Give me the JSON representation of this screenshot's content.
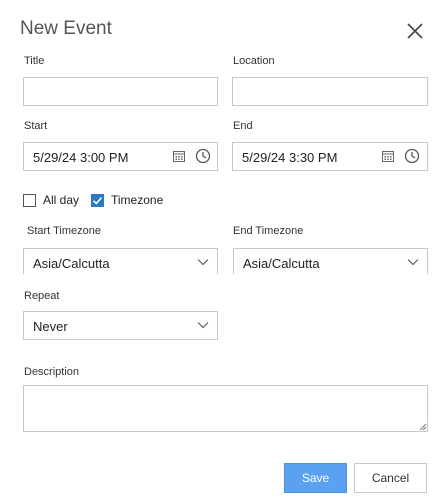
{
  "dialog": {
    "title": "New Event"
  },
  "fields": {
    "title_label": "Title",
    "title_value": "",
    "location_label": "Location",
    "location_value": "",
    "start_label": "Start",
    "start_value": "5/29/24 3:00 PM",
    "end_label": "End",
    "end_value": "5/29/24 3:30 PM"
  },
  "options": {
    "allday_label": "All day",
    "allday_checked": false,
    "timezone_label": "Timezone",
    "timezone_checked": true
  },
  "timezones": {
    "start_label": "Start Timezone",
    "start_value": "Asia/Calcutta",
    "end_label": "End Timezone",
    "end_value": "Asia/Calcutta"
  },
  "repeat": {
    "label": "Repeat",
    "value": "Never"
  },
  "description": {
    "label": "Description",
    "value": ""
  },
  "buttons": {
    "save": "Save",
    "cancel": "Cancel"
  },
  "colors": {
    "accent": "#5aa2f0",
    "checkbox_checked": "#2a79c2",
    "border": "#c8c8c8"
  },
  "icons": [
    "close-icon",
    "calendar-icon",
    "clock-icon",
    "checkmark-icon",
    "chevron-down-icon",
    "resize-grip-icon"
  ]
}
